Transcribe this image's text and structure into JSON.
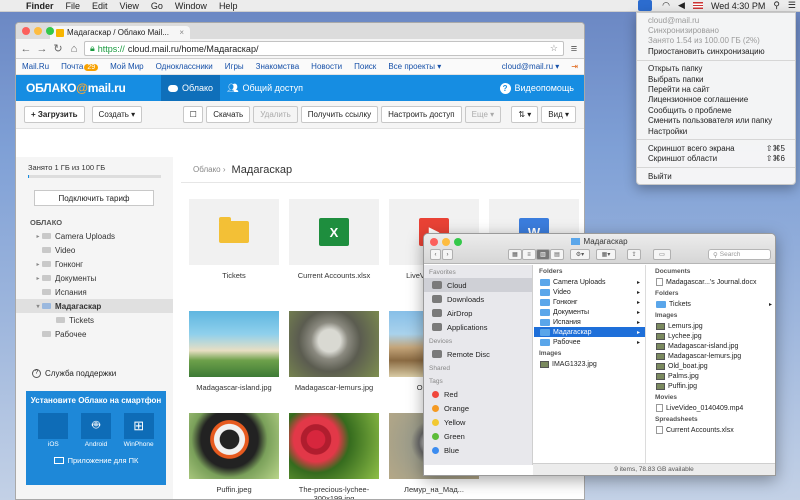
{
  "menubar": {
    "app_name": "Finder",
    "items": [
      "File",
      "Edit",
      "View",
      "Go",
      "Window",
      "Help"
    ],
    "clock": "Wed 4:30 PM"
  },
  "browser": {
    "tab_title": "Мадагаскар / Облако Mail...",
    "url_scheme": "https://",
    "url_rest": "cloud.mail.ru/home/Мадагаскар/",
    "portal_links": [
      "Mail.Ru",
      "Почта",
      "Мой Мир",
      "Одноклассники",
      "Игры",
      "Знакомства",
      "Новости",
      "Поиск",
      "Все проекты ▾"
    ],
    "mail_badge": "29",
    "user_email": "cloud@mail.ru ▾",
    "logo_left": "ОБЛАКО",
    "logo_at": "@",
    "logo_right": "mail.ru",
    "nav_cloud": "Облако",
    "nav_shared": "Общий доступ",
    "help": "Видеопомощь",
    "toolbar": {
      "upload": "+ Загрузить",
      "create": "Создать ▾",
      "download": "Скачать",
      "delete": "Удалить",
      "get_link": "Получить ссылку",
      "access": "Настроить доступ",
      "more": "Еще ▾",
      "sort": "⇅ ▾",
      "view": "Вид ▾"
    },
    "sidebar": {
      "quota_text": "Занято 1 ГБ из 100 ГБ",
      "quota_fraction": 0.01,
      "tariff_button": "Подключить тариф",
      "tree_header": "ОБЛАКО",
      "tree": [
        {
          "label": "Camera Uploads",
          "arrow": "▸",
          "indent": 0
        },
        {
          "label": "Video",
          "arrow": "",
          "indent": 0
        },
        {
          "label": "Гонконг",
          "arrow": "▸",
          "indent": 0
        },
        {
          "label": "Документы",
          "arrow": "▸",
          "indent": 0
        },
        {
          "label": "Испания",
          "arrow": "",
          "indent": 0
        },
        {
          "label": "Мадагаскар",
          "arrow": "▾",
          "indent": 0,
          "selected": true
        },
        {
          "label": "Tickets",
          "arrow": "",
          "indent": 1
        },
        {
          "label": "Рабочее",
          "arrow": "",
          "indent": 0
        }
      ],
      "support": "Служба поддержки",
      "promo_title": "Установите Облако на смартфон",
      "promo_ios": "iOS",
      "promo_android": "Android",
      "promo_winphone": "WinPhone",
      "promo_pc": "Приложение для ПК"
    },
    "breadcrumb_root": "Облако",
    "breadcrumb_current": "Мадагаскар",
    "files": [
      {
        "name": "Tickets",
        "kind": "folder"
      },
      {
        "name": "Current Accounts.xlsx",
        "kind": "xlsx",
        "letter": "X"
      },
      {
        "name": "LiveVideo_014...",
        "kind": "video",
        "letter": "▶"
      },
      {
        "name": "",
        "kind": "docx",
        "letter": "W"
      },
      {
        "name": "Madagascar-island.jpg",
        "kind": "photo"
      },
      {
        "name": "Madagascar-lemurs.jpg",
        "kind": "photo"
      },
      {
        "name": "Old_boa...",
        "kind": "photo"
      },
      {
        "name": "Puffin.jpeg",
        "kind": "photo"
      },
      {
        "name": "The-precious-lychee-300x199.jpg",
        "kind": "photo"
      },
      {
        "name": "Лемур_на_Мад...",
        "kind": "photo"
      }
    ]
  },
  "finder": {
    "title": "Мадагаскар",
    "search_placeholder": "Search",
    "sidebar": {
      "favorites_header": "Favorites",
      "favorites": [
        "Cloud",
        "Downloads",
        "AirDrop",
        "Applications"
      ],
      "devices_header": "Devices",
      "devices": [
        "Remote Disc"
      ],
      "shared_header": "Shared",
      "tags_header": "Tags",
      "tags": [
        {
          "label": "Red",
          "color": "#f0473c"
        },
        {
          "label": "Orange",
          "color": "#f59a23"
        },
        {
          "label": "Yellow",
          "color": "#f2c931"
        },
        {
          "label": "Green",
          "color": "#5cbc39"
        },
        {
          "label": "Blue",
          "color": "#3c8cf0"
        }
      ]
    },
    "col1": {
      "folders_header": "Folders",
      "folders": [
        "Camera Uploads",
        "Video",
        "Гонконг",
        "Документы",
        "Испания",
        "Мадагаскар",
        "Рабочее"
      ],
      "selected": "Мадагаскар",
      "images_header": "Images",
      "images": [
        "IMAG1323.jpg"
      ]
    },
    "col2": {
      "documents_header": "Documents",
      "documents": [
        "Madagascar...'s Journal.docx"
      ],
      "folders_header": "Folders",
      "folders": [
        "Tickets"
      ],
      "images_header": "Images",
      "images": [
        "Lemurs.jpg",
        "Lychee.jpg",
        "Madagascar-island.jpg",
        "Madagascar-lemurs.jpg",
        "Old_boat.jpg",
        "Palms.jpg",
        "Puffin.jpg"
      ],
      "movies_header": "Movies",
      "movies": [
        "LiveVideo_0140409.mp4"
      ],
      "spreadsheets_header": "Spreadsheets",
      "spreadsheets": [
        "Current Accounts.xlsx"
      ]
    },
    "status": "9 items, 78.83 GB available"
  },
  "dropdown": {
    "account": "cloud@mail.ru",
    "status": "Синхронизировано",
    "usage": "Занято 1.54 из 100.00 ГБ (2%)",
    "pause": "Приостановить синхронизацию",
    "items": [
      "Открыть папку",
      "Выбрать папки",
      "Перейти на сайт",
      "Лицензионное соглашение",
      "Сообщить о проблеме",
      "Сменить пользователя или папку",
      "Настройки"
    ],
    "screenshot_full": "Скриншот всего экрана",
    "screenshot_full_shortcut": "⇧⌘5",
    "screenshot_area": "Скриншот области",
    "screenshot_area_shortcut": "⇧⌘6",
    "quit": "Выйти"
  }
}
